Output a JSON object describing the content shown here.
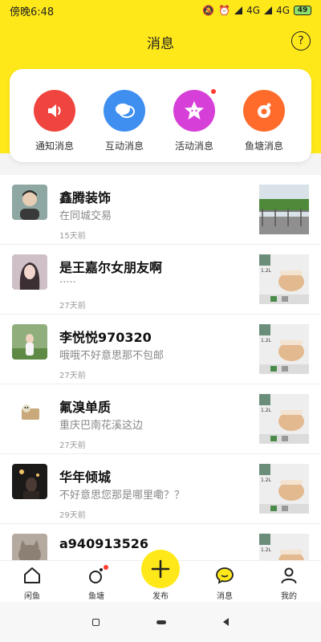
{
  "status_bar": {
    "time": "傍晚6:48",
    "network_1": "4G",
    "network_2": "4G",
    "battery": "49"
  },
  "header": {
    "title": "消息",
    "help_icon": "question-circle-icon"
  },
  "colors": {
    "brand_yellow": "#ffe81a",
    "badge_red": "#ff3b30"
  },
  "categories": [
    {
      "label": "通知消息",
      "icon": "speaker-icon",
      "color": "#f0443f"
    },
    {
      "label": "互动消息",
      "icon": "chat-bubbles-icon",
      "color": "#3f8ff0"
    },
    {
      "label": "活动消息",
      "icon": "star-face-icon",
      "color": "#d63fd8",
      "badge": true
    },
    {
      "label": "鱼塘消息",
      "icon": "pond-icon",
      "color": "#ff6b2b"
    }
  ],
  "messages": [
    {
      "name": "鑫腾装饰",
      "preview": "在同城交易",
      "time": "15天前",
      "avatar": "man-portrait",
      "thumb": "outdoor-fence-photo"
    },
    {
      "name": "是王嘉尔女朋友啊",
      "preview": "·····",
      "time": "27天前",
      "avatar": "girl-portrait",
      "thumb": "electric-cooker-ad"
    },
    {
      "name": "李悦悦970320",
      "preview": "哦哦不好意思那不包邮",
      "time": "27天前",
      "avatar": "girl-outdoor",
      "thumb": "electric-cooker-ad"
    },
    {
      "name": "氟溴单质",
      "preview": "重庆巴南花溪这边",
      "time": "27天前",
      "avatar": "cartoon-cat",
      "thumb": "electric-cooker-ad"
    },
    {
      "name": "华年倾城",
      "preview": "不好意思您那是哪里嘞？？",
      "time": "29天前",
      "avatar": "night-photo",
      "thumb": "electric-cooker-ad"
    },
    {
      "name": "a940913526",
      "preview": "",
      "time": "",
      "avatar": "cat-photo",
      "thumb": "electric-cooker-ad"
    }
  ],
  "thumb_text": {
    "cooker_capacity": "1.2L"
  },
  "tabs": [
    {
      "label": "闲鱼",
      "icon": "home-icon"
    },
    {
      "label": "鱼塘",
      "icon": "pond-icon",
      "badge": true
    },
    {
      "label": "发布",
      "icon": "plus-icon"
    },
    {
      "label": "消息",
      "icon": "message-bubble-icon"
    },
    {
      "label": "我的",
      "icon": "person-icon"
    }
  ]
}
